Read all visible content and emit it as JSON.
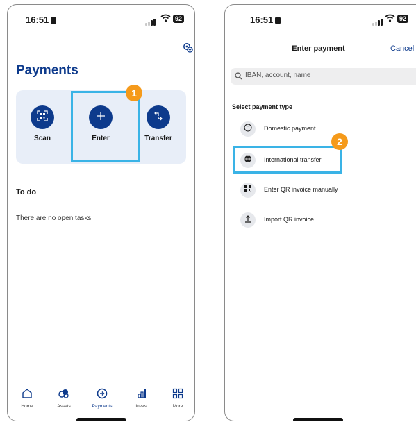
{
  "status": {
    "time": "16:51",
    "battery": "92"
  },
  "left": {
    "title": "Payments",
    "actions": [
      {
        "label": "Scan",
        "icon": "qr-scan-icon"
      },
      {
        "label": "Enter",
        "icon": "plus-icon"
      },
      {
        "label": "Transfer",
        "icon": "transfer-arrows-icon"
      }
    ],
    "step_badge": "1",
    "todo_title": "To do",
    "todo_empty": "There are no open tasks",
    "tabs": [
      {
        "label": "Home",
        "icon": "home-icon"
      },
      {
        "label": "Assets",
        "icon": "assets-icon"
      },
      {
        "label": "Payments",
        "icon": "payments-icon",
        "active": true
      },
      {
        "label": "Invest",
        "icon": "invest-icon"
      },
      {
        "label": "More",
        "icon": "grid-icon"
      }
    ]
  },
  "right": {
    "title": "Enter payment",
    "cancel": "Cancel",
    "search_placeholder": "IBAN, account, name",
    "section_title": "Select payment type",
    "payment_types": [
      {
        "label": "Domestic payment",
        "icon": "franc-icon"
      },
      {
        "label": "International transfer",
        "icon": "globe-icon"
      },
      {
        "label": "Enter QR invoice manually",
        "icon": "qr-code-icon"
      },
      {
        "label": "Import QR invoice",
        "icon": "upload-icon"
      }
    ],
    "step_badge": "2"
  },
  "colors": {
    "brand": "#0d3a8c",
    "highlight": "#3ab3e6",
    "badge": "#f59a1b"
  }
}
